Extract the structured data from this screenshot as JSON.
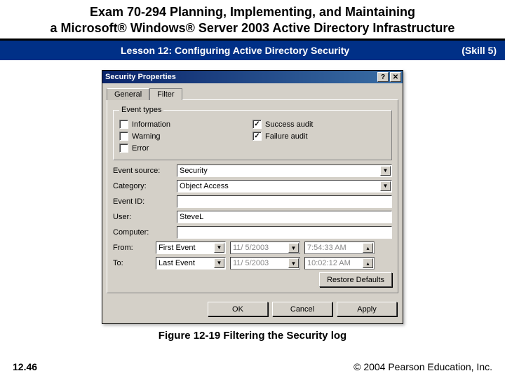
{
  "slide": {
    "title_line1": "Exam 70-294 Planning, Implementing, and Maintaining",
    "title_line2": "a Microsoft® Windows® Server 2003 Active Directory Infrastructure",
    "lesson": "Lesson 12: Configuring Active Directory Security",
    "skill": "(Skill 5)",
    "figure_caption": "Figure 12-19 Filtering the Security log",
    "page_number": "12.46",
    "copyright": "© 2004 Pearson Education, Inc."
  },
  "dialog": {
    "title": "Security Properties",
    "help_btn": "?",
    "close_btn": "✕",
    "tabs": {
      "general": "General",
      "filter": "Filter"
    },
    "group_legend": "Event types",
    "checks": {
      "information": "Information",
      "warning": "Warning",
      "error": "Error",
      "success_audit": "Success audit",
      "failure_audit": "Failure audit"
    },
    "labels": {
      "event_source": "Event source:",
      "category": "Category:",
      "event_id": "Event ID:",
      "user": "User:",
      "computer": "Computer:",
      "from": "From:",
      "to": "To:"
    },
    "values": {
      "event_source": "Security",
      "category": "Object Access",
      "event_id": "",
      "user": "SteveL",
      "computer": "",
      "from_sel": "First Event",
      "from_date": "11/ 5/2003",
      "from_time": "7:54:33 AM",
      "to_sel": "Last Event",
      "to_date": "11/ 5/2003",
      "to_time": "10:02:12 AM"
    },
    "buttons": {
      "restore": "Restore Defaults",
      "ok": "OK",
      "cancel": "Cancel",
      "apply": "Apply"
    }
  }
}
